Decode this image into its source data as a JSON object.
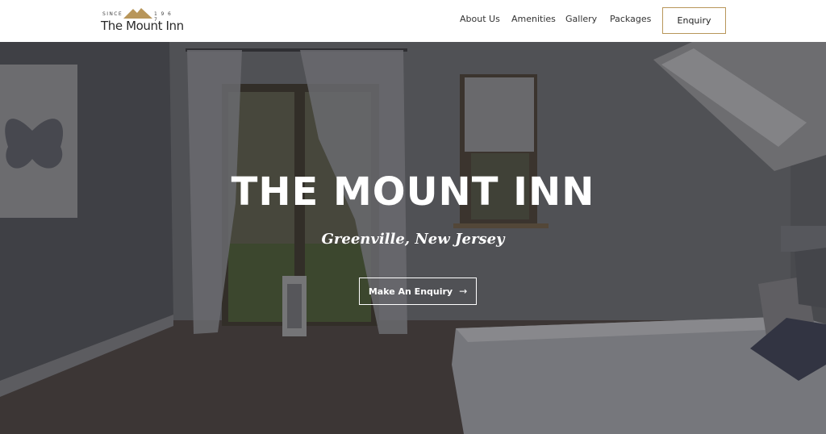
{
  "logo": {
    "since": "SINCE",
    "year": "1 9 6 7",
    "name": "The Mount Inn",
    "mountain_icon": "mountain-icon"
  },
  "nav": {
    "items": [
      {
        "label": "About Us"
      },
      {
        "label": "Amenities"
      },
      {
        "label": "Gallery"
      },
      {
        "label": "Packages"
      }
    ],
    "enquiry_label": "Enquiry"
  },
  "hero": {
    "title": "THE MOUNT INN",
    "subtitle": "Greenville, New Jersey",
    "cta_label": "Make An Enquiry",
    "cta_icon": "arrow-right-icon"
  },
  "colors": {
    "accent_gold": "#b8965a",
    "header_bg": "#ffffff",
    "hero_text": "#ffffff"
  }
}
